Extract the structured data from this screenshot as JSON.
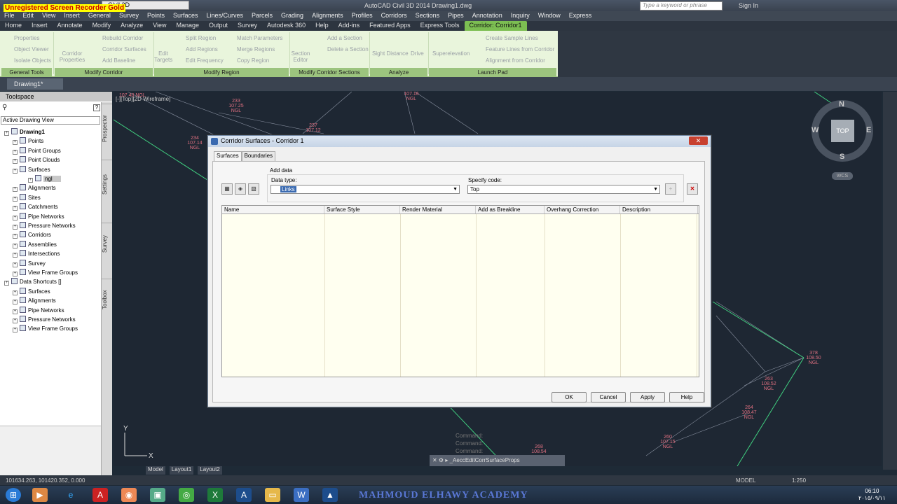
{
  "watermark": "Unregistered Screen Recorder Gold",
  "app_title": "AutoCAD Civil 3D 2014   Drawing1.dwg",
  "workspace": "Civil 3D",
  "search_placeholder": "Type a keyword or phrase",
  "sign_in": "Sign In",
  "menu": [
    "File",
    "Edit",
    "View",
    "Insert",
    "General",
    "Survey",
    "Points",
    "Surfaces",
    "Lines/Curves",
    "Parcels",
    "Grading",
    "Alignments",
    "Profiles",
    "Corridors",
    "Sections",
    "Pipes",
    "Annotation",
    "Inquiry",
    "Window",
    "Express"
  ],
  "ribbon_tabs": [
    "Home",
    "Insert",
    "Annotate",
    "Modify",
    "Analyze",
    "View",
    "Manage",
    "Output",
    "Survey",
    "Autodesk 360",
    "Help",
    "Add-ins",
    "Featured Apps",
    "Express Tools",
    "Corridor: Corridor1"
  ],
  "ribbon": {
    "general_tools": [
      "Properties",
      "Object Viewer",
      "Isolate Objects"
    ],
    "general_tools_title": "General Tools",
    "corridor_properties": "Corridor Properties",
    "modify_corridor": [
      "Rebuild Corridor",
      "Corridor Surfaces",
      "Add Baseline"
    ],
    "modify_corridor_title": "Modify Corridor",
    "edit_targets": "Edit Targets",
    "modify_region_a": [
      "Split Region",
      "Add Regions",
      "Edit Frequency"
    ],
    "modify_region_b": [
      "Match Parameters",
      "Merge Regions",
      "Copy Region"
    ],
    "modify_region_title": "Modify Region",
    "section_editor": "Section Editor",
    "sections_items": [
      "Add a Section",
      "Delete a Section"
    ],
    "sections_title": "Modify Corridor Sections",
    "sight_distance": "Sight Distance",
    "drive": "Drive",
    "analyze_title": "Analyze",
    "superelevation": "Superelevation",
    "launch_items": [
      "Create Sample Lines",
      "Feature Lines from Corridor",
      "Alignment from Corridor"
    ],
    "launch_title": "Launch Pad"
  },
  "file_tab": "Drawing1*",
  "toolspace": {
    "title": "Toolspace",
    "view_dropdown": "Active Drawing View",
    "side_tabs": [
      "Prospector",
      "Settings",
      "Survey",
      "Toolbox"
    ],
    "tree": [
      {
        "label": "Drawing1",
        "indent": 0,
        "bold": true
      },
      {
        "label": "Points",
        "indent": 1
      },
      {
        "label": "Point Groups",
        "indent": 1
      },
      {
        "label": "Point Clouds",
        "indent": 1
      },
      {
        "label": "Surfaces",
        "indent": 1
      },
      {
        "label": "ngl",
        "indent": 2,
        "selected": true
      },
      {
        "label": "Alignments",
        "indent": 1
      },
      {
        "label": "Sites",
        "indent": 1
      },
      {
        "label": "Catchments",
        "indent": 1
      },
      {
        "label": "Pipe Networks",
        "indent": 1
      },
      {
        "label": "Pressure Networks",
        "indent": 1
      },
      {
        "label": "Corridors",
        "indent": 1
      },
      {
        "label": "Assemblies",
        "indent": 1
      },
      {
        "label": "Intersections",
        "indent": 1
      },
      {
        "label": "Survey",
        "indent": 1
      },
      {
        "label": "View Frame Groups",
        "indent": 1
      },
      {
        "label": "Data Shortcuts []",
        "indent": 0
      },
      {
        "label": "Surfaces",
        "indent": 1
      },
      {
        "label": "Alignments",
        "indent": 1
      },
      {
        "label": "Pipe Networks",
        "indent": 1
      },
      {
        "label": "Pressure Networks",
        "indent": 1
      },
      {
        "label": "View Frame Groups",
        "indent": 1
      }
    ]
  },
  "viewport_label": "[-][Top][2D Wireframe]",
  "viewcube": {
    "n": "N",
    "s": "S",
    "e": "E",
    "w": "W",
    "top": "TOP",
    "wcs": "WCS"
  },
  "dialog": {
    "title": "Corridor Surfaces - Corridor 1",
    "tabs": [
      "Surfaces",
      "Boundaries"
    ],
    "add_data": "Add data",
    "data_type_label": "Data type:",
    "data_type_value": "Links",
    "specify_code_label": "Specify code:",
    "specify_code_value": "Top",
    "columns": [
      "Name",
      "Surface Style",
      "Render Material",
      "Add as Breakline",
      "Overhang Correction",
      "Description"
    ],
    "buttons": {
      "ok": "OK",
      "cancel": "Cancel",
      "apply": "Apply",
      "help": "Help"
    }
  },
  "command_history": [
    "Command:",
    "Command:",
    "Command:"
  ],
  "command_line": "_AeccEditCorrSurfaceProps",
  "layout_tabs": [
    "Model",
    "Layout1",
    "Layout2"
  ],
  "coords": "101634.263, 101420.352, 0.000",
  "status_model": "MODEL",
  "scale": "1:250",
  "academy": "MAHMOUD ELHAWY ACADEMY",
  "clock": {
    "time": "06:10",
    "date": "٢٠١٥/٠٩/١١"
  },
  "point_labels": [
    {
      "text": "107.40 NGL"
    },
    {
      "text": "233 107.25 NGL"
    },
    {
      "text": "237 107.12"
    },
    {
      "text": "234 107.14 NGL"
    },
    {
      "text": "107.16 NGL"
    },
    {
      "text": "378 108.50 NGL"
    },
    {
      "text": "263 108.52 NGL"
    },
    {
      "text": "264 108.47 NGL"
    },
    {
      "text": "260 107.15 NGL"
    },
    {
      "text": "268 108.54"
    }
  ],
  "colors": {
    "ribbon_green": "#e9f5dc",
    "context_tab": "#7cbe52",
    "dialog_border": "#6f86a3",
    "label_red": "#e07080"
  }
}
